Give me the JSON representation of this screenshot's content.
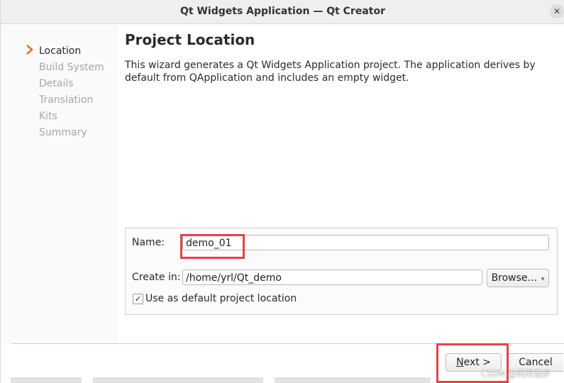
{
  "window": {
    "title": "Qt Widgets Application — Qt Creator",
    "close_symbol": "✕"
  },
  "sidebar": {
    "items": [
      {
        "label": "Location",
        "active": true
      },
      {
        "label": "Build System",
        "active": false
      },
      {
        "label": "Details",
        "active": false
      },
      {
        "label": "Translation",
        "active": false
      },
      {
        "label": "Kits",
        "active": false
      },
      {
        "label": "Summary",
        "active": false
      }
    ]
  },
  "page": {
    "title": "Project Location",
    "description": "This wizard generates a Qt Widgets Application project. The application derives by default from QApplication and includes an empty widget."
  },
  "form": {
    "name_label": "Name:",
    "name_value": "demo_01",
    "create_in_label": "Create in:",
    "create_in_value": "/home/yrl/Qt_demo",
    "browse_label": "Browse...",
    "browse_arrow": "▾",
    "default_checkbox_label": "Use as default project location",
    "default_checkbox_checked": true,
    "check_mark": "✓"
  },
  "buttons": {
    "next_mnemonic": "N",
    "next_rest": "ext >",
    "cancel_label": "Cancel"
  },
  "watermark": "CSDN @码河漫步",
  "colors": {
    "highlight": "#e8404a",
    "active_arrow": "#e0661c"
  }
}
